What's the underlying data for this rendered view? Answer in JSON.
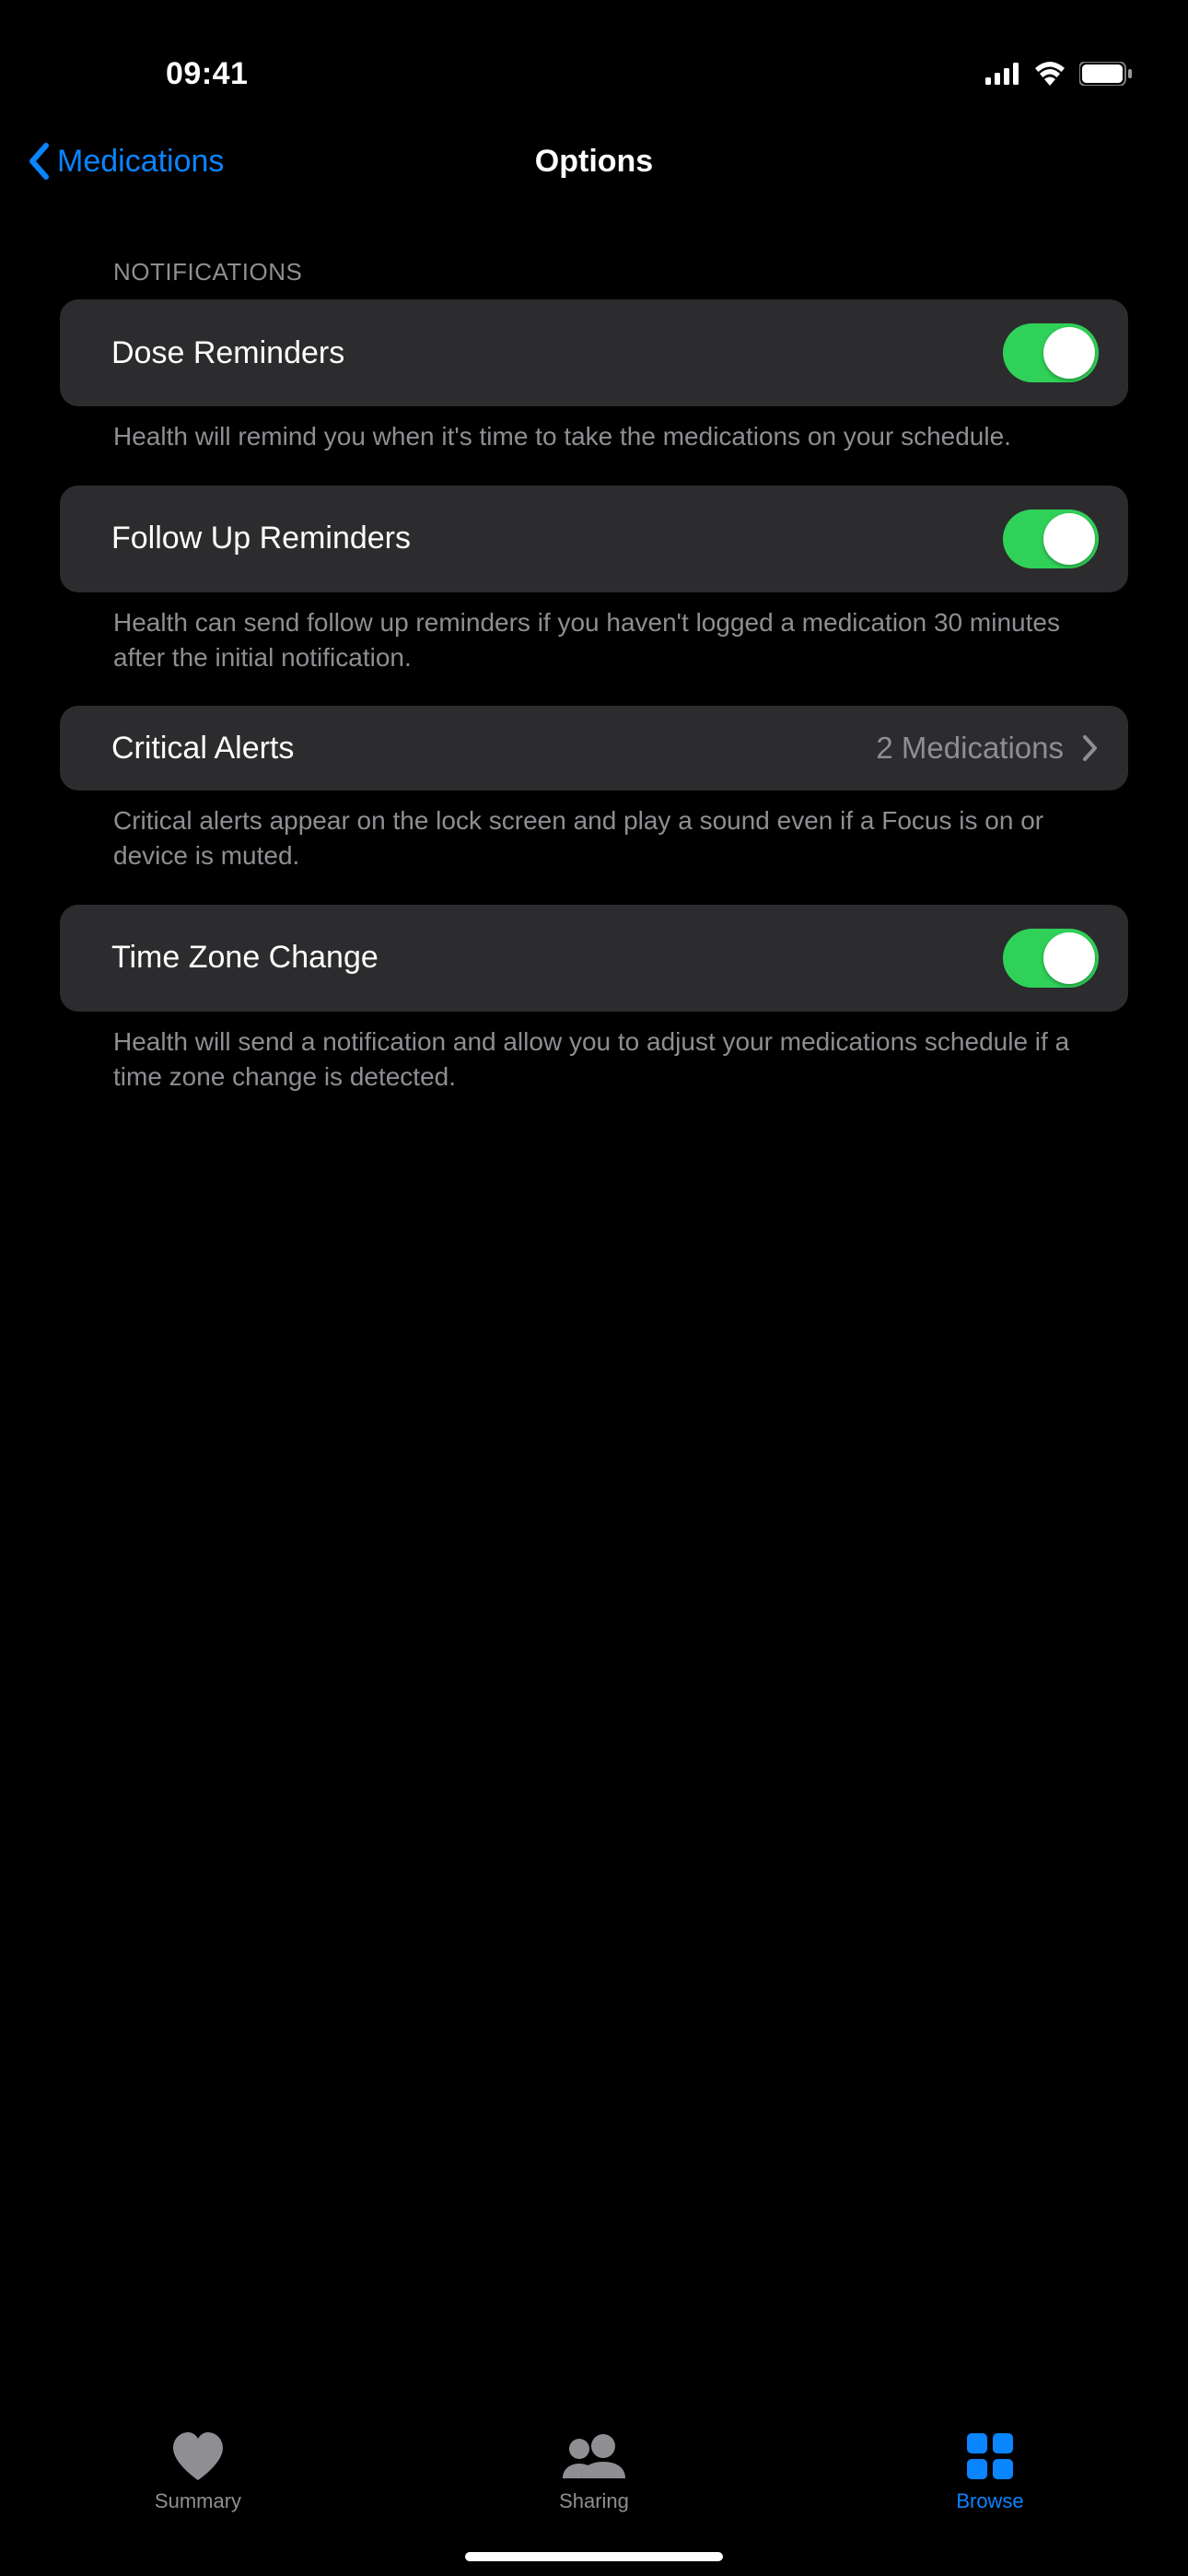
{
  "statusBar": {
    "time": "09:41"
  },
  "nav": {
    "backLabel": "Medications",
    "title": "Options"
  },
  "section": {
    "header": "NOTIFICATIONS",
    "rows": {
      "doseReminders": {
        "label": "Dose Reminders",
        "footer": "Health will remind you when it's time to take the medications on your schedule.",
        "on": true
      },
      "followUp": {
        "label": "Follow Up Reminders",
        "footer": "Health can send follow up reminders if you haven't logged a medication 30 minutes after the initial notification.",
        "on": true
      },
      "criticalAlerts": {
        "label": "Critical Alerts",
        "detail": "2 Medications",
        "footer": "Critical alerts appear on the lock screen and play a sound even if a Focus is on or device is muted."
      },
      "timeZone": {
        "label": "Time Zone Change",
        "footer": "Health will send a notification and allow you to adjust your medications schedule if a time zone change is detected.",
        "on": true
      }
    }
  },
  "tabs": {
    "summary": "Summary",
    "sharing": "Sharing",
    "browse": "Browse"
  }
}
